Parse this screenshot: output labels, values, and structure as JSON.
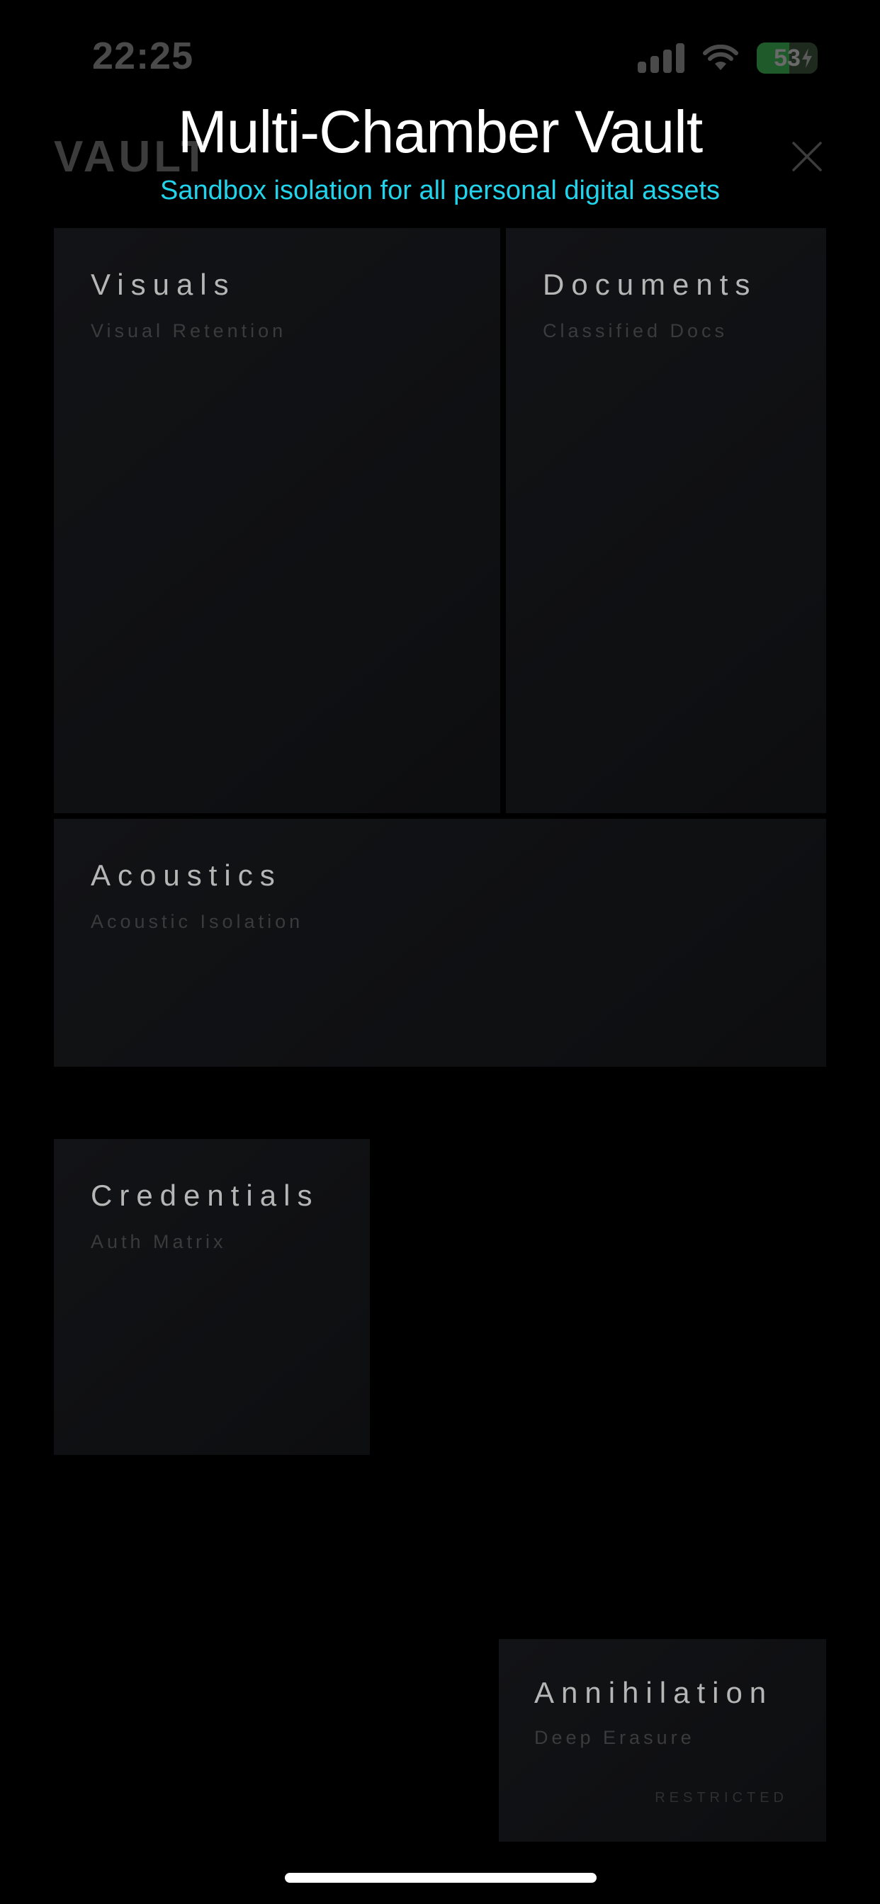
{
  "status_bar": {
    "time": "22:25",
    "battery_percent": "53",
    "battery_level": 0.53,
    "signal_icon": "cellular-signal-icon",
    "wifi_icon": "wifi-icon",
    "charging_icon": "charging-bolt-icon"
  },
  "header": {
    "brand": "VAULT",
    "close_icon": "close-icon"
  },
  "overlay": {
    "title": "Multi-Chamber Vault",
    "subtitle": "Sandbox isolation for all personal digital assets"
  },
  "chambers": [
    {
      "title": "Visuals",
      "subtitle": "Visual Retention"
    },
    {
      "title": "Documents",
      "subtitle": "Classified Docs"
    },
    {
      "title": "Acoustics",
      "subtitle": "Acoustic Isolation"
    },
    {
      "title": "Credentials",
      "subtitle": "Auth Matrix"
    },
    {
      "title": "Annihilation",
      "subtitle": "Deep Erasure",
      "tag": "RESTRICTED"
    }
  ],
  "colors": {
    "background": "#000000",
    "subtitle_accent": "#21d4ec",
    "card_background": "#121316",
    "card_title": "#b6b6b6",
    "card_subtitle": "#3b3b3d",
    "battery_green": "#1f5a2a"
  }
}
